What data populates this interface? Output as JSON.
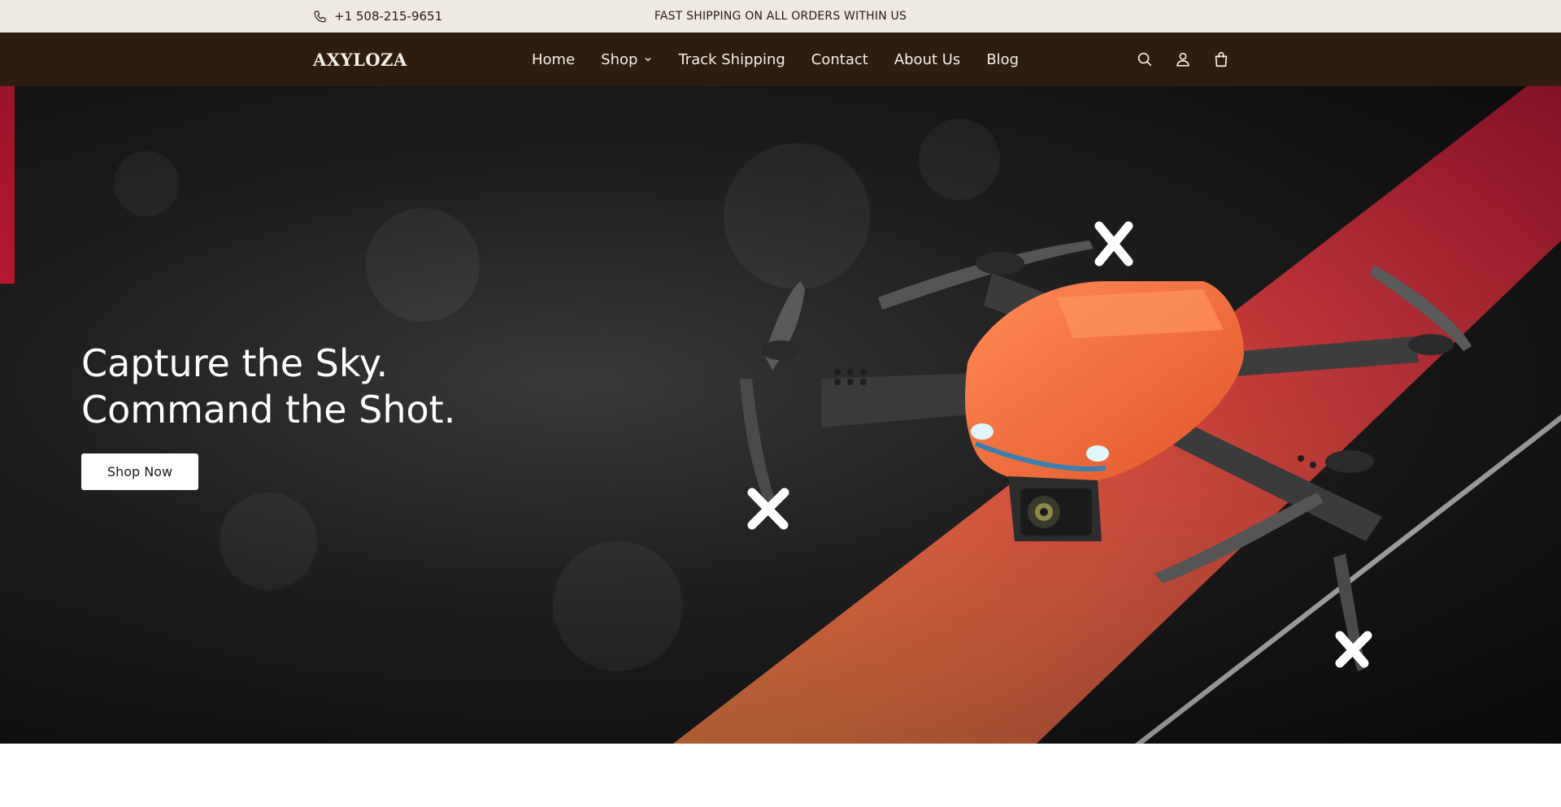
{
  "topbar": {
    "phone": "+1 508-215-9651",
    "announcement": "FAST SHIPPING ON ALL ORDERS WITHIN US",
    "phone_icon": "phone-icon"
  },
  "header": {
    "logo": "AXYLOZA",
    "nav": [
      {
        "label": "Home"
      },
      {
        "label": "Shop",
        "has_dropdown": true
      },
      {
        "label": "Track Shipping"
      },
      {
        "label": "Contact"
      },
      {
        "label": "About Us"
      },
      {
        "label": "Blog"
      }
    ],
    "icons": [
      "search-icon",
      "account-icon",
      "cart-icon"
    ]
  },
  "hero": {
    "title_line1": "Capture the Sky.",
    "title_line2": "Command the Shot.",
    "cta": "Shop Now"
  },
  "colors": {
    "topbar_bg": "#eee9e3",
    "header_bg": "#2e1c0e",
    "accent_red": "#f0203e",
    "accent_orange": "#ff7a45",
    "drone_orange": "#f0703e"
  }
}
